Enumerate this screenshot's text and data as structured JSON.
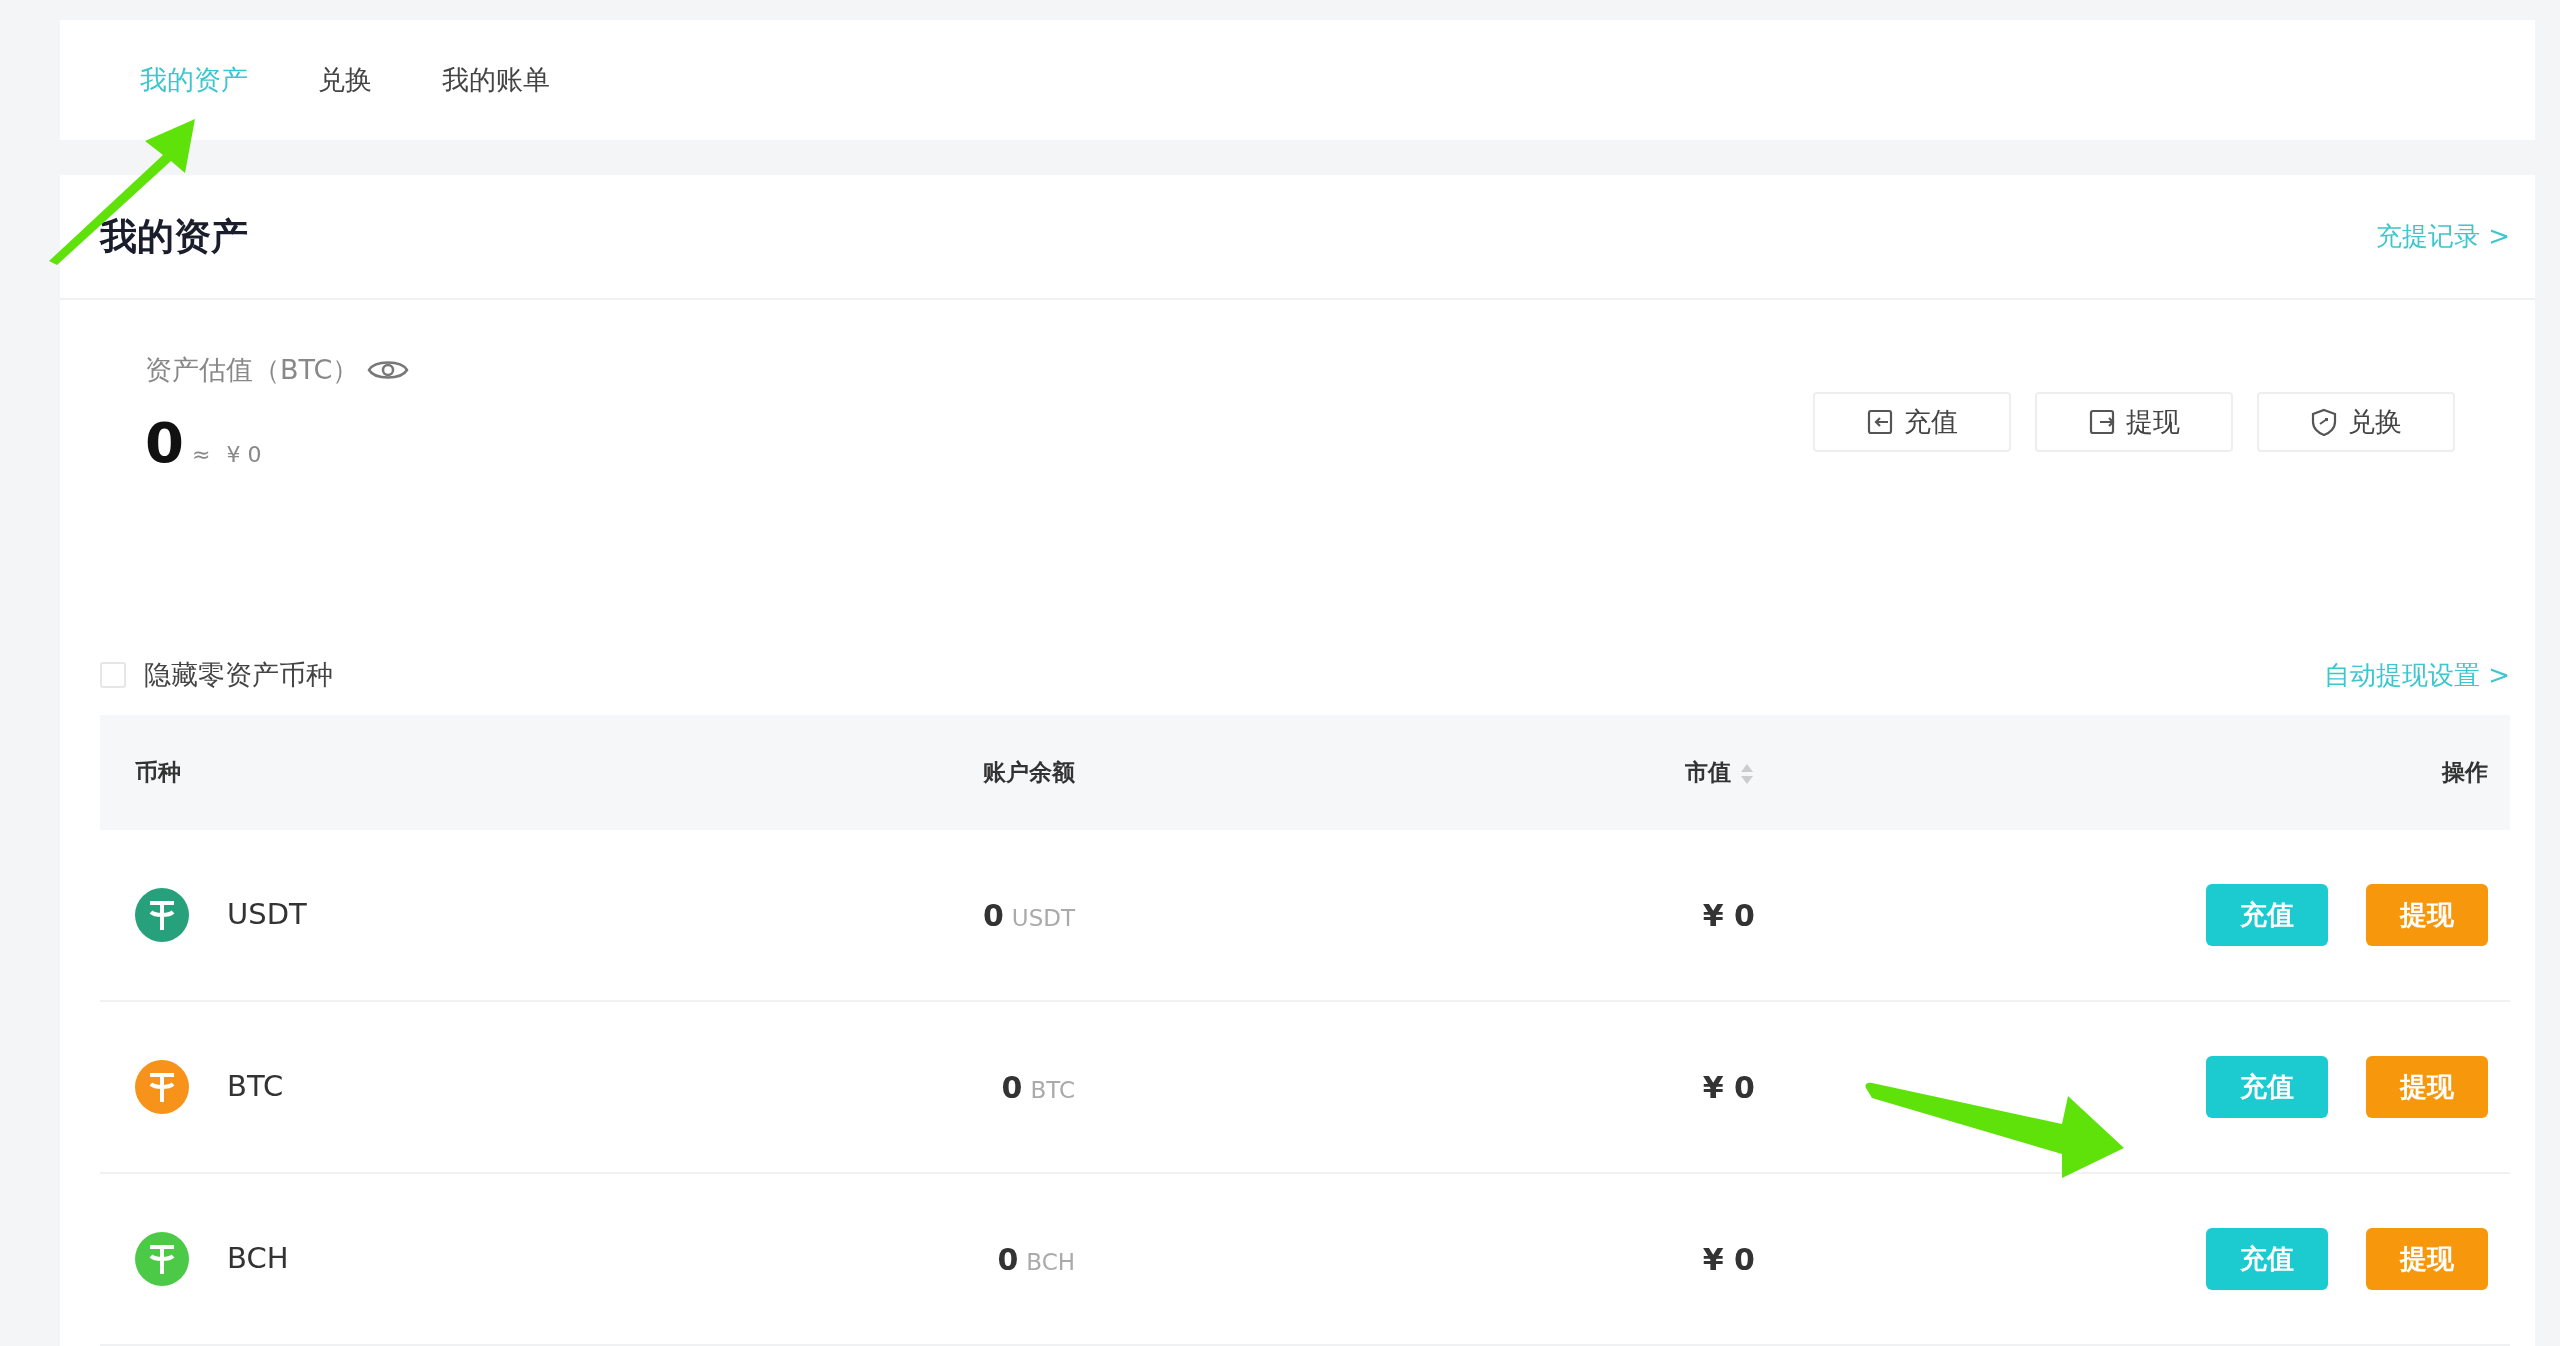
{
  "tabs": [
    {
      "label": "我的资产",
      "selected": true
    },
    {
      "label": "兑换",
      "selected": false
    },
    {
      "label": "我的账单",
      "selected": false
    }
  ],
  "header": {
    "title": "我的资产",
    "link": "充提记录 >"
  },
  "valuation": {
    "label": "资产估值（BTC）",
    "amount": "0",
    "approx": "≈",
    "fiat": "¥ 0"
  },
  "actions": [
    {
      "kind": "deposit",
      "label": "充值"
    },
    {
      "kind": "withdraw",
      "label": "提现"
    },
    {
      "kind": "exchange",
      "label": "兑换"
    }
  ],
  "hide_zero": {
    "label": "隐藏零资产币种",
    "checked": false
  },
  "auto_withdraw_link": "自动提现设置 >",
  "table": {
    "columns": [
      "币种",
      "账户余额",
      "市值",
      "操作"
    ],
    "rows": [
      {
        "coin": "USDT",
        "color": "#26a17b",
        "balance": "0",
        "unit": "USDT",
        "value": "¥ 0",
        "deposit": "充值",
        "withdraw": "提现"
      },
      {
        "coin": "BTC",
        "color": "#f7931a",
        "balance": "0",
        "unit": "BTC",
        "value": "¥ 0",
        "deposit": "充值",
        "withdraw": "提现"
      },
      {
        "coin": "BCH",
        "color": "#4cca47",
        "balance": "0",
        "unit": "BCH",
        "value": "¥ 0",
        "deposit": "充值",
        "withdraw": "提现"
      }
    ]
  }
}
